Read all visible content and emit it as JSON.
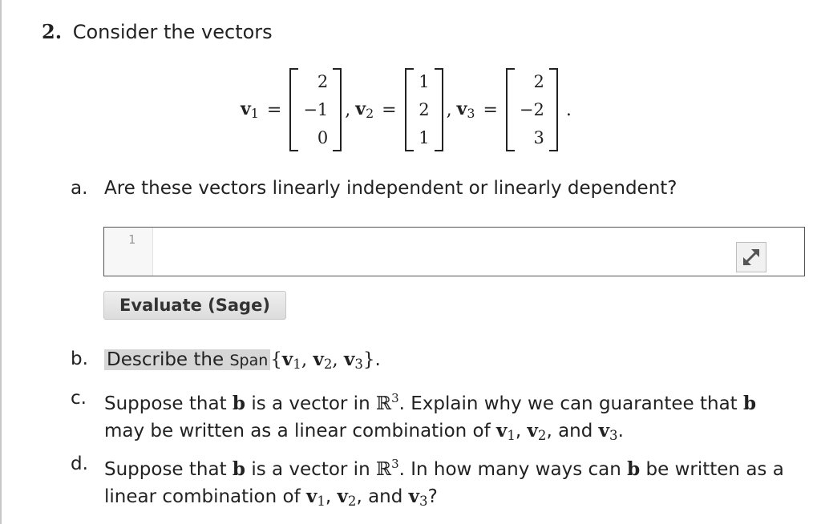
{
  "problem": {
    "number": "2.",
    "intro": "Consider the vectors"
  },
  "vectors": {
    "v1": {
      "name": "v",
      "sub": "1",
      "entries": [
        "2",
        "−1",
        "0"
      ]
    },
    "v2": {
      "name": "v",
      "sub": "2",
      "entries": [
        "1",
        "2",
        "1"
      ]
    },
    "v3": {
      "name": "v",
      "sub": "3",
      "entries": [
        "2",
        "−2",
        "3"
      ]
    }
  },
  "parts": {
    "a": {
      "letter": "a.",
      "text": "Are these vectors linearly independent or linearly dependent?"
    },
    "b": {
      "letter": "b.",
      "text_before": "Describe the ",
      "span_word": "Span",
      "set_text": "{v1, v2, v3}"
    },
    "c": {
      "letter": "c.",
      "t1": "Suppose that ",
      "b": "b",
      "t2": " is a vector in ",
      "R": "ℝ",
      "exp": "3",
      "t3": ". Explain why we can guarantee that ",
      "t4": "may be written as a linear combination of ",
      "t5": ", and "
    },
    "d": {
      "letter": "d.",
      "t1": "Suppose that ",
      "t2": " is a vector in ",
      "t3": ". In how many ways can ",
      "t4": " be written as a",
      "t5": "linear combination of ",
      "t6": ", and ",
      "t7": "?"
    }
  },
  "code_cell": {
    "line_number": "1",
    "value": "",
    "expand_icon": "expand-arrows-icon"
  },
  "evaluate_button": {
    "label": "Evaluate (Sage)"
  }
}
